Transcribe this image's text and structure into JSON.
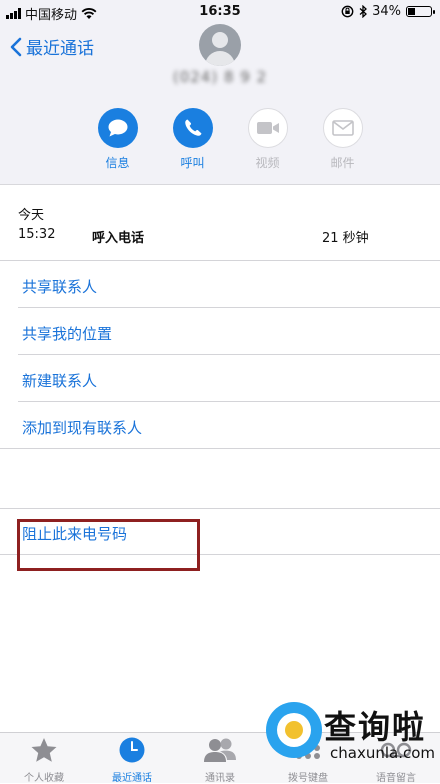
{
  "status_bar": {
    "carrier": "中国移动",
    "time": "16:35",
    "battery": "34%",
    "battery_level": 0.34
  },
  "header": {
    "back_label": "最近通话",
    "phone_number": "(024) 8 9 2"
  },
  "actions": [
    {
      "label": "信息",
      "icon": "message-icon",
      "enabled": true
    },
    {
      "label": "呼叫",
      "icon": "phone-icon",
      "enabled": true
    },
    {
      "label": "视频",
      "icon": "video-icon",
      "enabled": false
    },
    {
      "label": "邮件",
      "icon": "mail-icon",
      "enabled": false
    }
  ],
  "call_log": {
    "day": "今天",
    "time": "15:32",
    "type": "呼入电话",
    "duration": "21 秒钟"
  },
  "options": [
    "共享联系人",
    "共享我的位置",
    "新建联系人",
    "添加到现有联系人",
    "阻止此来电号码"
  ],
  "tabs": [
    {
      "label": "个人收藏",
      "icon": "star-icon"
    },
    {
      "label": "最近通话",
      "icon": "clock-icon",
      "active": true
    },
    {
      "label": "通讯录",
      "icon": "contacts-icon"
    },
    {
      "label": "拨号键盘",
      "icon": "keypad-icon"
    },
    {
      "label": "语音留言",
      "icon": "voicemail-icon"
    }
  ],
  "watermark": {
    "title": "查询啦",
    "url": "chaxunla.com"
  },
  "colors": {
    "accent": "#1a7fe0",
    "link": "#1a73d9",
    "highlight_border": "#8e2020",
    "disabled": "#b8b8bd"
  }
}
